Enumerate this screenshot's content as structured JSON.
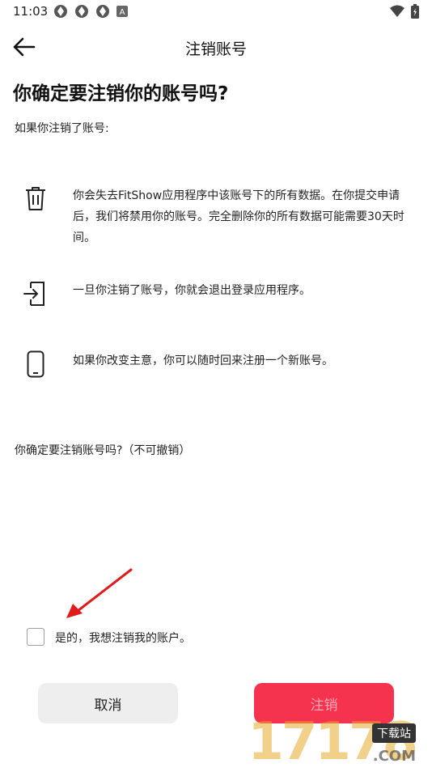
{
  "status_bar": {
    "time": "11:03",
    "notification_icons": [
      "sync-icon",
      "sync-icon",
      "sync-icon",
      "a-badge-icon"
    ],
    "right_icons": [
      "wifi-icon",
      "battery-icon"
    ]
  },
  "header": {
    "title": "注销账号",
    "back_icon": "arrow-left-icon"
  },
  "main": {
    "heading": "你确定要注销你的账号吗?",
    "intro": "如果你注销了账号:",
    "items": [
      {
        "icon": "trash-icon",
        "text": "你会失去FitShow应用程序中该账号下的所有数据。在你提交申请后，我们将禁用你的账号。完全删除你的所有数据可能需要30天时间。"
      },
      {
        "icon": "logout-icon",
        "text": "一旦你注销了账号，你就会退出登录应用程序。"
      },
      {
        "icon": "phone-icon",
        "text": "如果你改变主意，你可以随时回来注册一个新账号。"
      }
    ],
    "confirm_question": "你确定要注销账号吗?（不可撤销）"
  },
  "checkbox": {
    "checked": false,
    "label": "是的，我想注销我的账户。"
  },
  "buttons": {
    "cancel_label": "取消",
    "confirm_label": "注销"
  },
  "colors": {
    "confirm_button": "#f5334f",
    "annotation_arrow": "#e01b1b"
  },
  "watermark": {
    "digits": "17178",
    "badge": "下载站",
    "domain": ".COM"
  }
}
